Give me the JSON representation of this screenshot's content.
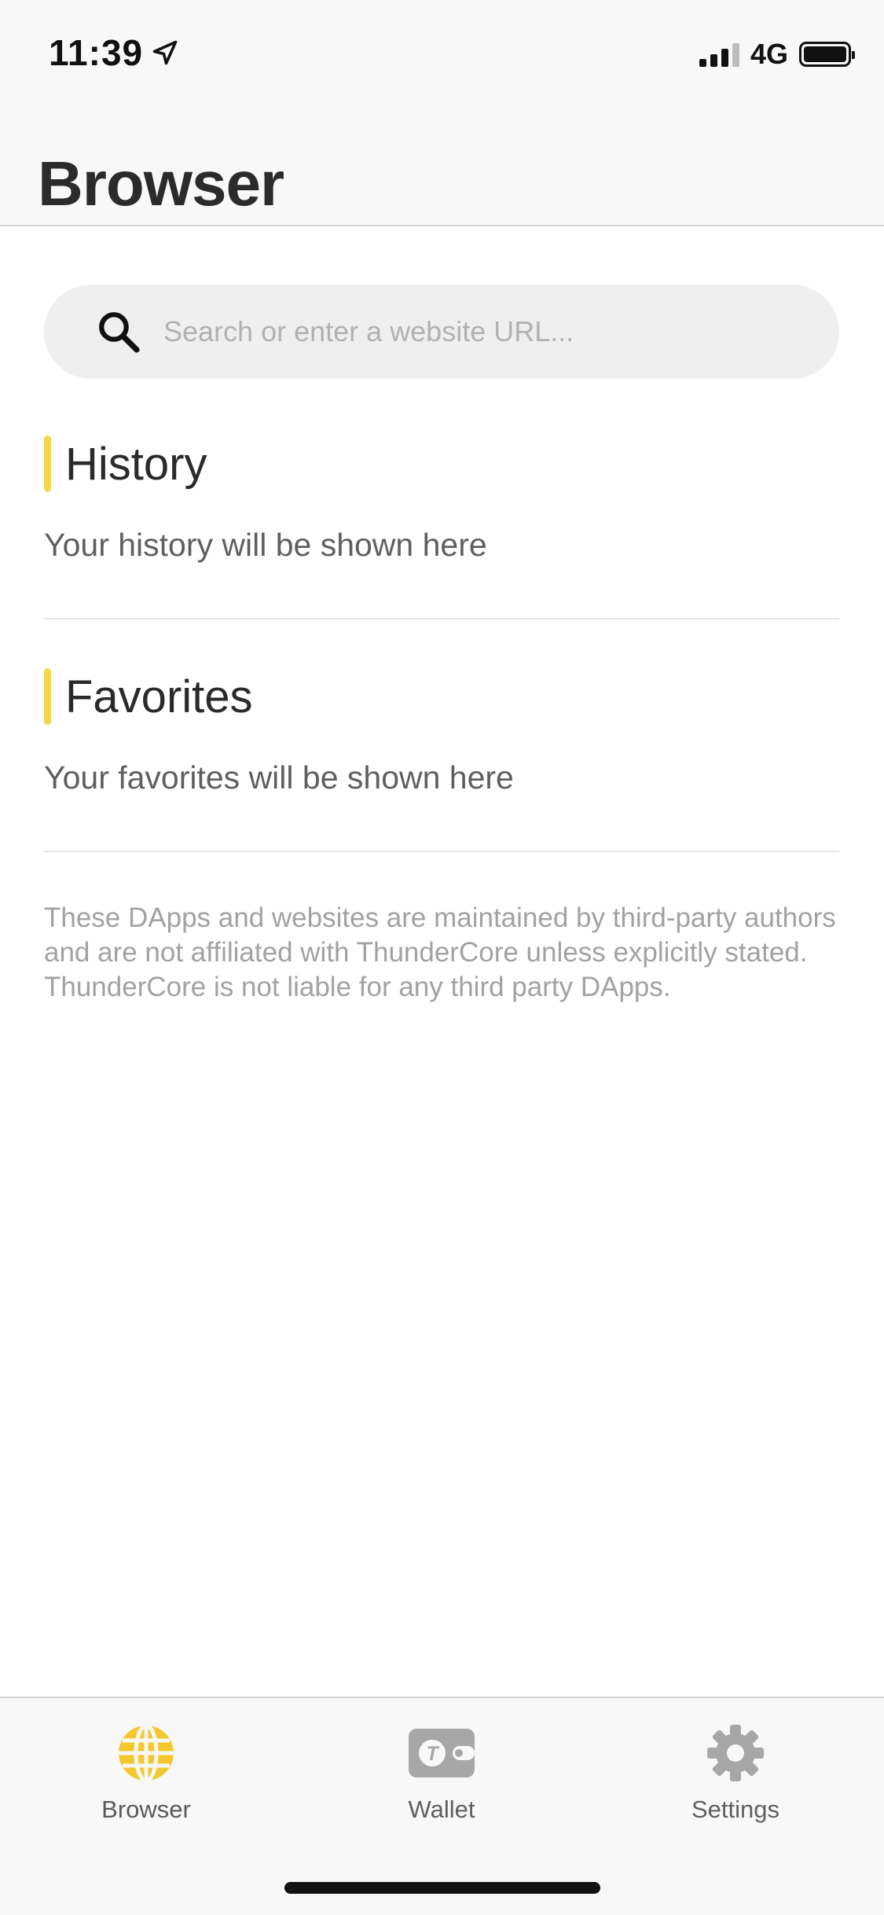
{
  "status_bar": {
    "time": "11:39",
    "network": "4G",
    "location_icon": "location-arrow-icon",
    "signal_icon": "signal-bars-icon",
    "battery_icon": "battery-icon"
  },
  "header": {
    "title": "Browser"
  },
  "search": {
    "placeholder": "Search or enter a website URL...",
    "value": "",
    "icon": "search-icon"
  },
  "sections": [
    {
      "title": "History",
      "empty_text": "Your history will be shown here"
    },
    {
      "title": "Favorites",
      "empty_text": "Your favorites will be shown here"
    }
  ],
  "disclaimer": "These DApps and websites are maintained by third-party authors and are not affiliated with ThunderCore unless explicitly stated. ThunderCore is not liable for any third party DApps.",
  "tab_bar": {
    "items": [
      {
        "label": "Browser",
        "icon": "globe-icon",
        "active": true
      },
      {
        "label": "Wallet",
        "icon": "wallet-icon",
        "active": false
      },
      {
        "label": "Settings",
        "icon": "gear-icon",
        "active": false
      }
    ]
  },
  "colors": {
    "accent": "#f2d84b",
    "tab_active": "#f3c92f",
    "tab_inactive": "#a7a7a7",
    "header_background": "#f8f8f8"
  }
}
